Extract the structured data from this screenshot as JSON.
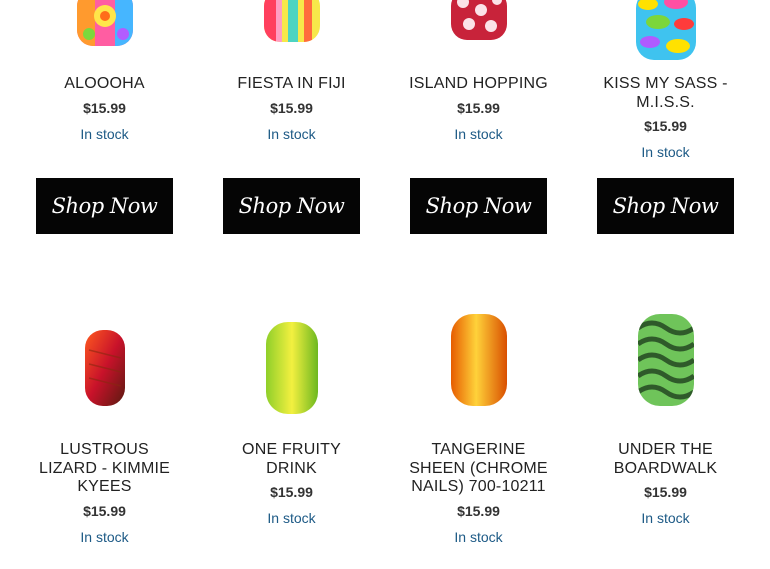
{
  "row1": [
    {
      "name": "ALOOOHA",
      "price": "$15.99",
      "stock": "In stock",
      "shop": "Shop Now"
    },
    {
      "name": "FIESTA IN FIJI",
      "price": "$15.99",
      "stock": "In stock",
      "shop": "Shop Now"
    },
    {
      "name": "ISLAND HOPPING",
      "price": "$15.99",
      "stock": "In stock",
      "shop": "Shop Now"
    },
    {
      "name": "KISS MY SASS - M.I.S.S.",
      "price": "$15.99",
      "stock": "In stock",
      "shop": "Shop Now"
    }
  ],
  "row2": [
    {
      "name": "LUSTROUS LIZARD - KIMMIE KYEES",
      "price": "$15.99",
      "stock": "In stock"
    },
    {
      "name": "ONE FRUITY DRINK",
      "price": "$15.99",
      "stock": "In stock"
    },
    {
      "name": "TANGERINE SHEEN (CHROME NAILS) 700-10211",
      "price": "$15.99",
      "stock": "In stock"
    },
    {
      "name": "UNDER THE BOARDWALK",
      "price": "$15.99",
      "stock": "In stock"
    }
  ]
}
